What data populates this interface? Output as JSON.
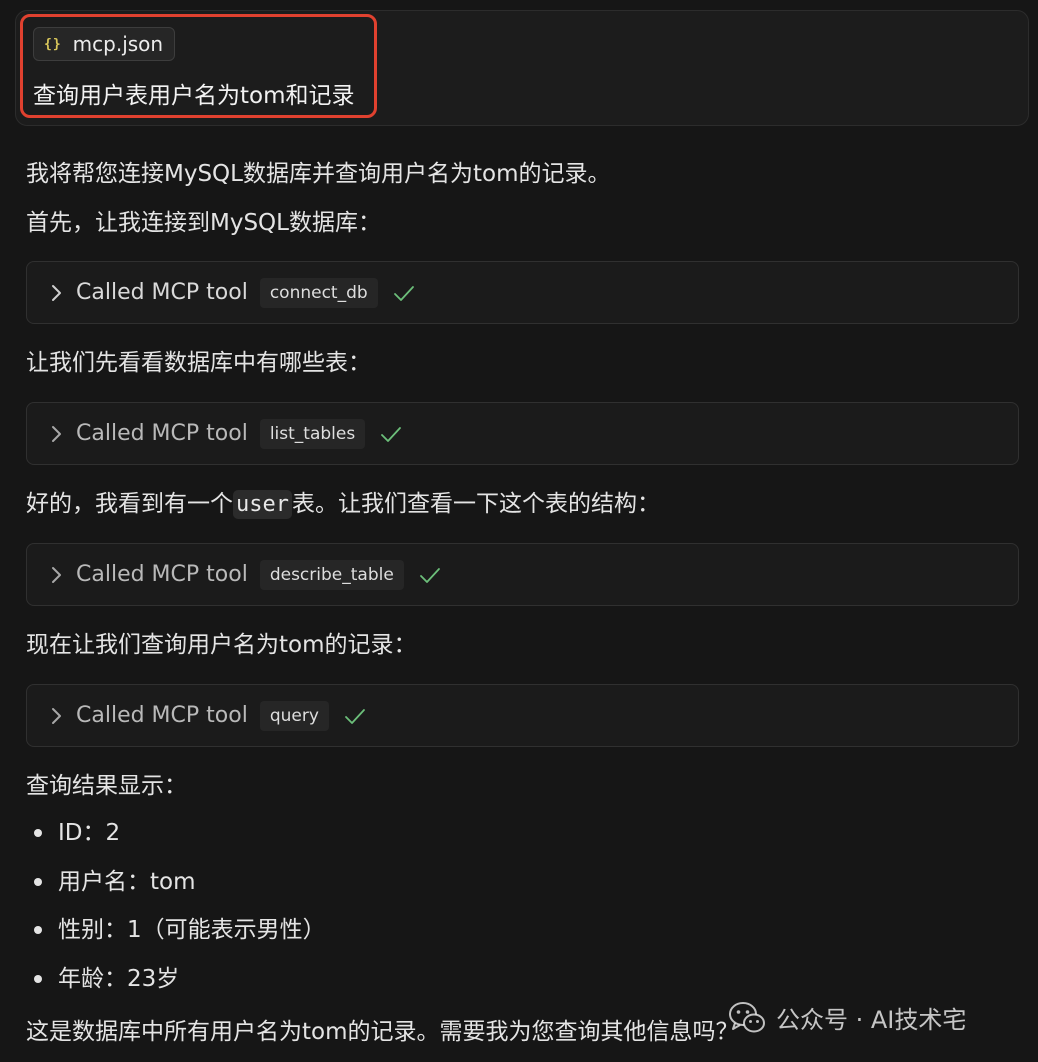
{
  "user_message": {
    "attachment": {
      "icon": "json-braces-icon",
      "icon_glyph": "{}",
      "filename": "mcp.json"
    },
    "text": "查询用户表用户名为tom和记录",
    "highlight_color": "#e0412f"
  },
  "response": {
    "intro": "我将帮您连接MySQL数据库并查询用户名为tom的记录。",
    "step1_text": "首先，让我连接到MySQL数据库：",
    "step2_text": "让我们先看看数据库中有哪些表：",
    "step3_prefix": "好的，我看到有一个",
    "step3_code": "user",
    "step3_suffix": "表。让我们查看一下这个表的结构：",
    "step4_text": "现在让我们查询用户名为tom的记录：",
    "result_heading": "查询结果显示：",
    "results": [
      "ID：2",
      "用户名：tom",
      "性别：1（可能表示男性）",
      "年龄：23岁"
    ],
    "closing": "这是数据库中所有用户名为tom的记录。需要我为您查询其他信息吗？"
  },
  "tool_calls": [
    {
      "label": "Called MCP tool",
      "tool": "connect_db",
      "status": "success"
    },
    {
      "label": "Called MCP tool",
      "tool": "list_tables",
      "status": "success"
    },
    {
      "label": "Called MCP tool",
      "tool": "describe_table",
      "status": "success"
    },
    {
      "label": "Called MCP tool",
      "tool": "query",
      "status": "success"
    }
  ],
  "colors": {
    "success_check": "#6cbf7a",
    "background": "#161616"
  },
  "watermark": {
    "icon": "wechat-icon",
    "text": "公众号 · AI技术宅"
  }
}
